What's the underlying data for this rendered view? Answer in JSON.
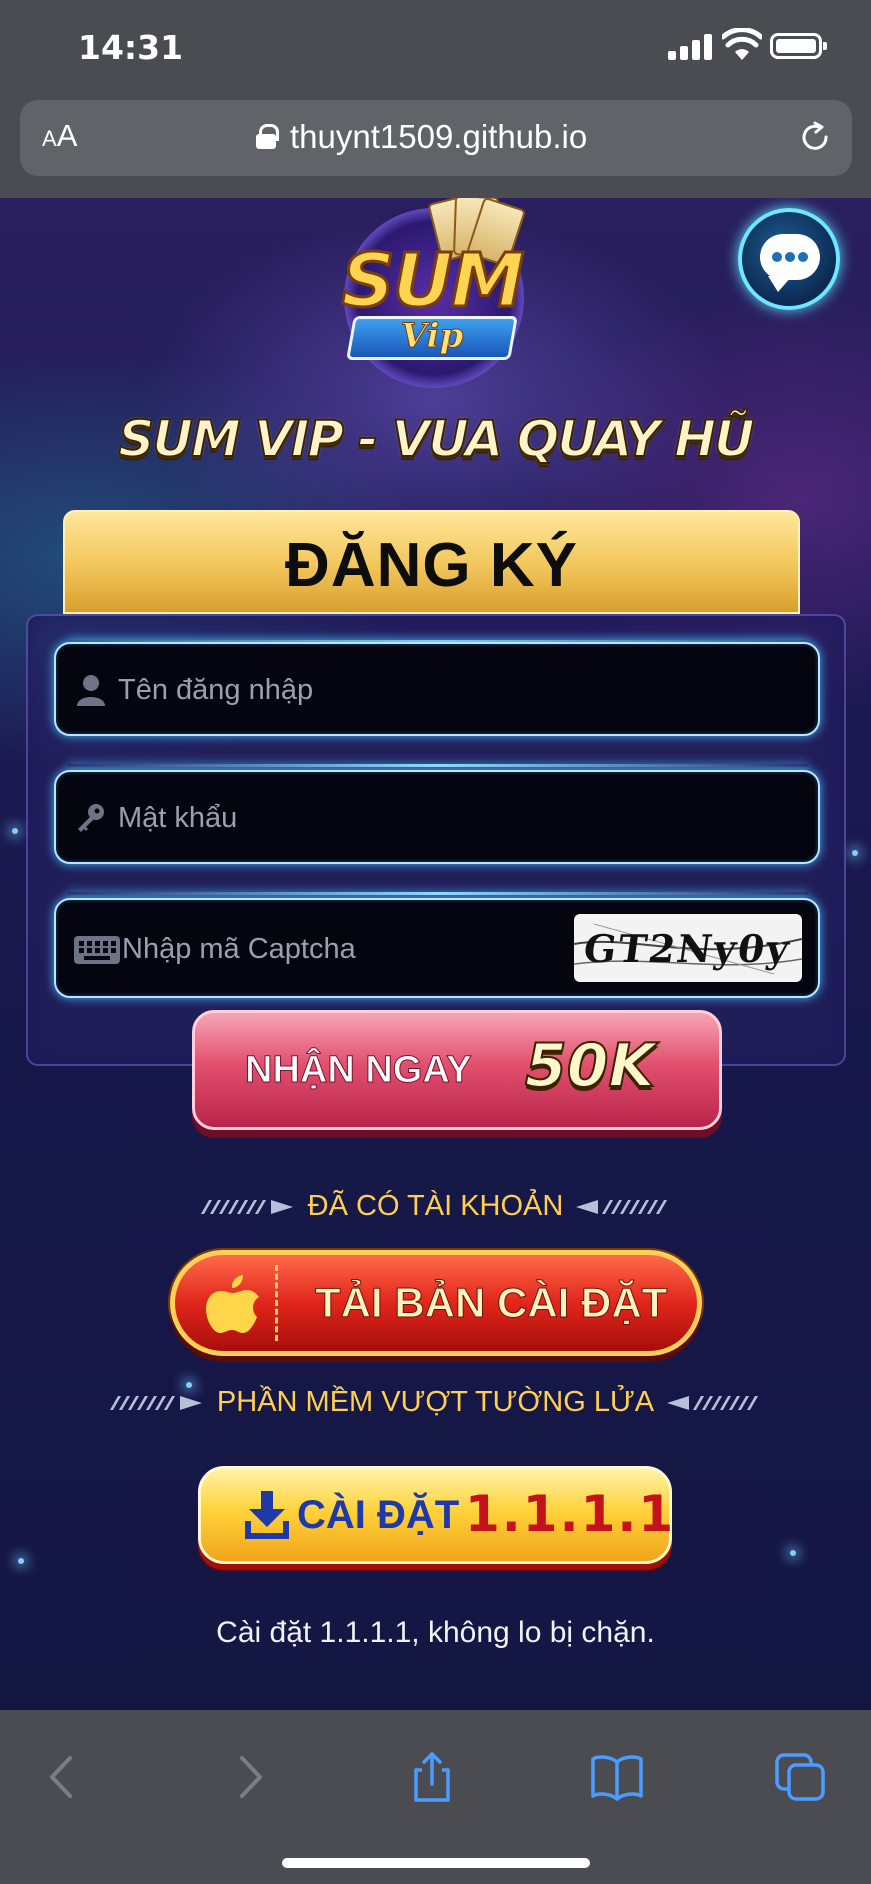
{
  "status_bar": {
    "time": "14:31"
  },
  "browser": {
    "text_size_button": {
      "small": "A",
      "large": "A"
    },
    "url": "thuynt1509.github.io"
  },
  "page": {
    "tagline": "SUM VIP - VUA QUAY HŨ",
    "logo": {
      "brand": "SUM",
      "sub": "Vip"
    },
    "register": {
      "title": "ĐĂNG KÝ",
      "username_placeholder": "Tên đăng nhập",
      "password_placeholder": "Mật khẩu",
      "captcha_placeholder": "Nhập mã Captcha",
      "captcha_code": "GT2Ny0y",
      "submit": {
        "label": "NHẬN NGAY",
        "amount": "50K"
      }
    },
    "has_account_label": "ĐÃ CÓ TÀI KHOẢN",
    "install_button": "TẢI BẢN CÀI ĐẶT",
    "firewall_label": "PHẦN MỀM VƯỢT TƯỜNG LỬA",
    "warp_button": {
      "label": "CÀI ĐẶT",
      "version": "1.1.1.1"
    },
    "footnote": "Cài đặt 1.1.1.1, không lo bị chặn."
  },
  "toolbar": {
    "icons": [
      "back-icon",
      "forward-icon",
      "share-icon",
      "bookmarks-icon",
      "tabs-icon"
    ]
  },
  "colors": {
    "accent_gold": "#ffcf4d",
    "field_glow": "#3fb4ff",
    "pink_button": "#e2506f",
    "red_button": "#e0261b"
  }
}
